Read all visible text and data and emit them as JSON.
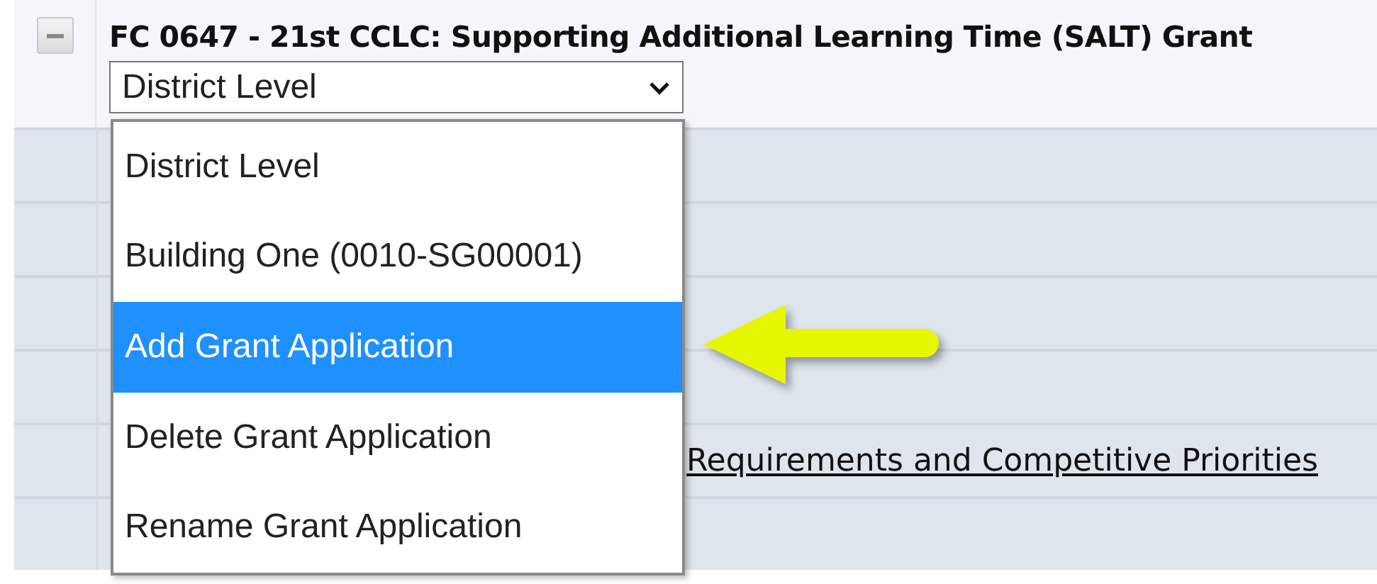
{
  "group": {
    "expanded": true,
    "title": "FC 0647 - 21st CCLC: Supporting Additional Learning Time (SALT) Grant"
  },
  "select": {
    "value": "District Level",
    "open": true
  },
  "menu": [
    {
      "label": "District Level",
      "selected": false
    },
    {
      "label": "Building One (0010-SG00001)",
      "selected": false
    },
    {
      "label": "Add Grant Application",
      "selected": true
    },
    {
      "label": "Delete Grant Application",
      "selected": false
    },
    {
      "label": "Rename Grant Application",
      "selected": false
    }
  ],
  "link": "Requirements and Competitive Priorities"
}
